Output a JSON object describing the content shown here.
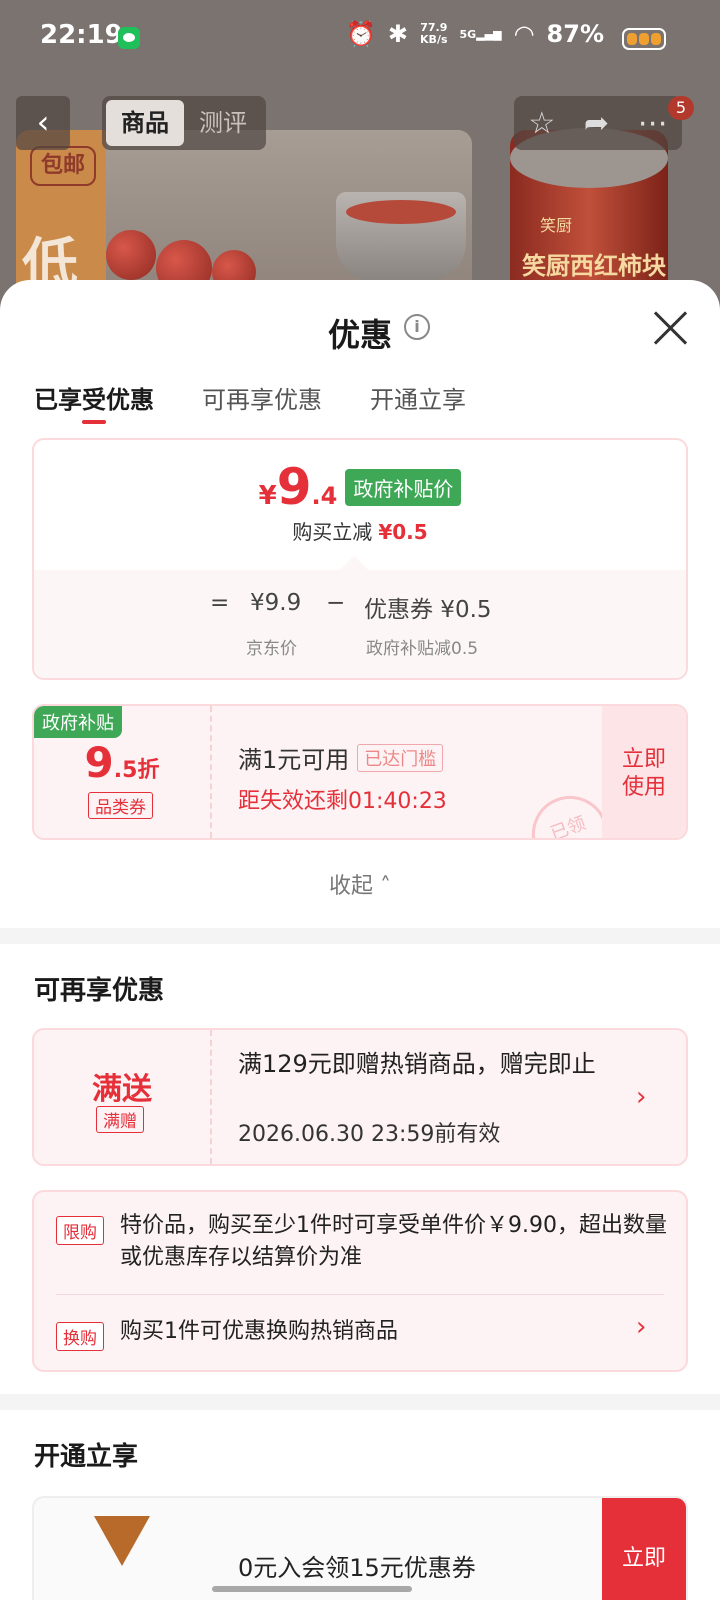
{
  "status_bar": {
    "time": "22:19",
    "speed": "77.9",
    "speed_unit": "KB/s",
    "network": "5G",
    "battery": "87%"
  },
  "backdrop": {
    "badge_baoyou": "包邮",
    "label_low": "低",
    "can_brand": "笑厨",
    "can_label": "笑厨西红柿块"
  },
  "nav": {
    "tabs": [
      "商品",
      "测评"
    ],
    "cart_count": "5"
  },
  "sheet": {
    "title": "优惠",
    "tabs": [
      "已享受优惠",
      "可再享优惠",
      "开通立享"
    ]
  },
  "price_card": {
    "currency": "¥",
    "price_int": "9",
    "price_dec": ".4",
    "gov_tag": "政府补贴价",
    "reduce_label": "购买立减",
    "reduce_value": "¥0.5",
    "equals": "=",
    "jd_price": "¥9.9",
    "minus": "−",
    "coupon_text": "优惠券 ¥0.5",
    "jd_price_label": "京东价",
    "gov_reduce_label": "政府补贴减0.5"
  },
  "coupon": {
    "corner_tag": "政府补贴",
    "discount_big": "9",
    "discount_small": ".5折",
    "category_tag": "品类券",
    "condition": "满1元可用",
    "met_tag": "已达门槛",
    "expire": "距失效还剩01:40:23",
    "action": "立即使用",
    "stamp": "已领"
  },
  "collapse_label": "收起",
  "section_more": {
    "title": "可再享优惠",
    "gift": {
      "big": "满送",
      "tag": "满赠",
      "desc": "满129元即赠热销商品，赠完即止",
      "valid": "2026.06.30 23:59前有效"
    },
    "rules": [
      {
        "tag": "限购",
        "text": "特价品，购买至少1件时可享受单件价￥9.90，超出数量或优惠库存以结算价为准"
      },
      {
        "tag": "换购",
        "text": "购买1件可优惠换购热销商品"
      }
    ]
  },
  "section_vip": {
    "title": "开通立享",
    "text": "0元入会领15元优惠券",
    "action": "立即"
  },
  "colors": {
    "accent_red": "#e5303a",
    "gov_green": "#3fa857",
    "card_bg": "#fdf3f4"
  }
}
